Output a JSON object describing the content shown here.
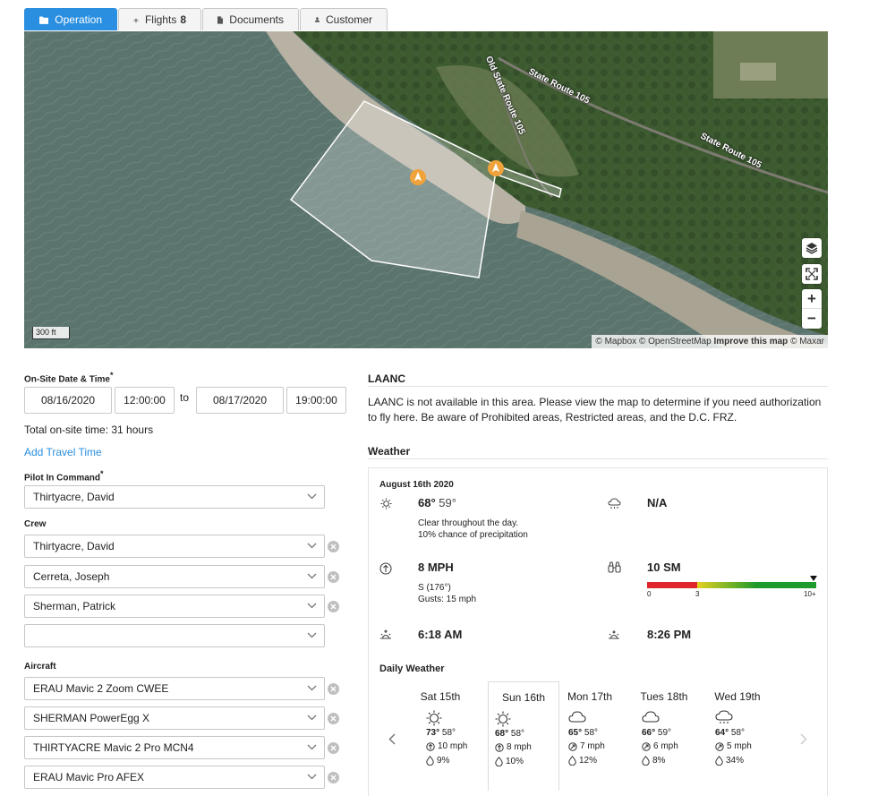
{
  "tabs": [
    {
      "label": "Operation",
      "icon": "folder-icon",
      "active": true
    },
    {
      "label": "Flights",
      "count": "8",
      "icon": "airplane-icon"
    },
    {
      "label": "Documents",
      "icon": "document-icon"
    },
    {
      "label": "Customer",
      "icon": "user-icon"
    }
  ],
  "map": {
    "roads": [
      "State Route 105",
      "Old State Route 105",
      "State Route 105"
    ],
    "scale": "300 ft",
    "attribution": {
      "mapbox": "© Mapbox",
      "osm": "© OpenStreetMap",
      "improve": "Improve this map",
      "maxar": "© Maxar"
    }
  },
  "form": {
    "onsite_label": "On-Site Date & Time",
    "start_date": "08/16/2020",
    "start_time": "12:00:00",
    "to": "to",
    "end_date": "08/17/2020",
    "end_time": "19:00:00",
    "total_time": "Total on-site time: 31 hours",
    "add_travel": "Add Travel Time",
    "pic_label": "Pilot In Command",
    "pic_value": "Thirtyacre, David",
    "crew_label": "Crew",
    "crew": [
      "Thirtyacre, David",
      "Cerreta, Joseph",
      "Sherman, Patrick",
      ""
    ],
    "aircraft_label": "Aircraft",
    "aircraft": [
      "ERAU Mavic 2 Zoom CWEE",
      "SHERMAN PowerEgg X",
      "THIRTYACRE Mavic 2 Pro MCN4",
      "ERAU Mavic Pro AFEX"
    ]
  },
  "laanc": {
    "title": "LAANC",
    "text": "LAANC is not available in this area. Please view the map to determine if you need authorization to fly here. Be aware of Prohibited areas, Restricted areas, and the D.C. FRZ."
  },
  "weather": {
    "title": "Weather",
    "date": "August 16th 2020",
    "high": "68°",
    "low": "59°",
    "summary": "Clear throughout the day.",
    "precip_chance": "10% chance of precipitation",
    "ceiling": "N/A",
    "wind_speed": "8 MPH",
    "wind_dir": "S (176°)",
    "gusts": "Gusts: 15 mph",
    "visibility": "10 SM",
    "vis_ticks": [
      "0",
      "3",
      "10+"
    ],
    "sunrise": "6:18 AM",
    "sunset": "8:26 PM",
    "daily_title": "Daily Weather",
    "days": [
      {
        "name": "Sat 15th",
        "icon": "sun-icon",
        "high": "73°",
        "low": "58°",
        "wind": "10 mph",
        "precip": "9%"
      },
      {
        "name": "Sun 16th",
        "icon": "sun-icon",
        "high": "68°",
        "low": "58°",
        "wind": "8 mph",
        "precip": "10%"
      },
      {
        "name": "Mon 17th",
        "icon": "cloud-icon",
        "high": "65°",
        "low": "58°",
        "wind": "7 mph",
        "precip": "12%"
      },
      {
        "name": "Tues 18th",
        "icon": "cloud-icon",
        "high": "66°",
        "low": "59°",
        "wind": "6 mph",
        "precip": "8%"
      },
      {
        "name": "Wed 19th",
        "icon": "rain-cloud-icon",
        "high": "64°",
        "low": "58°",
        "wind": "5 mph",
        "precip": "34%"
      }
    ],
    "colors": {
      "red": "#e0262b",
      "yellow": "#e4d21f",
      "green": "#1f9a2c"
    }
  }
}
